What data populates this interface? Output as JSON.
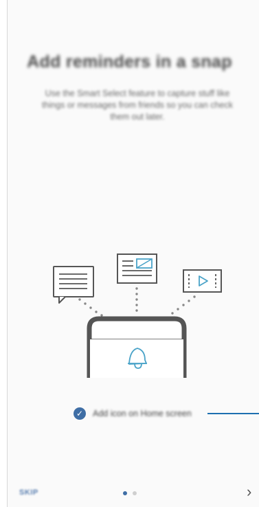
{
  "screen": {
    "title": "Add reminders in a snap",
    "description": "Use the Smart Select feature to capture stuff like things or messages from friends so you can check them out later.",
    "option_label": "Add icon on Home screen",
    "option_checked": true,
    "skip_label": "SKIP",
    "next_symbol": "›",
    "page_current": 1,
    "page_total": 2
  },
  "icons": [
    "message-icon",
    "image-note-icon",
    "video-icon",
    "phone-icon",
    "bell-icon",
    "check-icon"
  ],
  "colors": {
    "accent": "#3f6ea5",
    "callout": "#1e6fb0",
    "illustration": "#555555",
    "bell": "#4aa3c8"
  }
}
